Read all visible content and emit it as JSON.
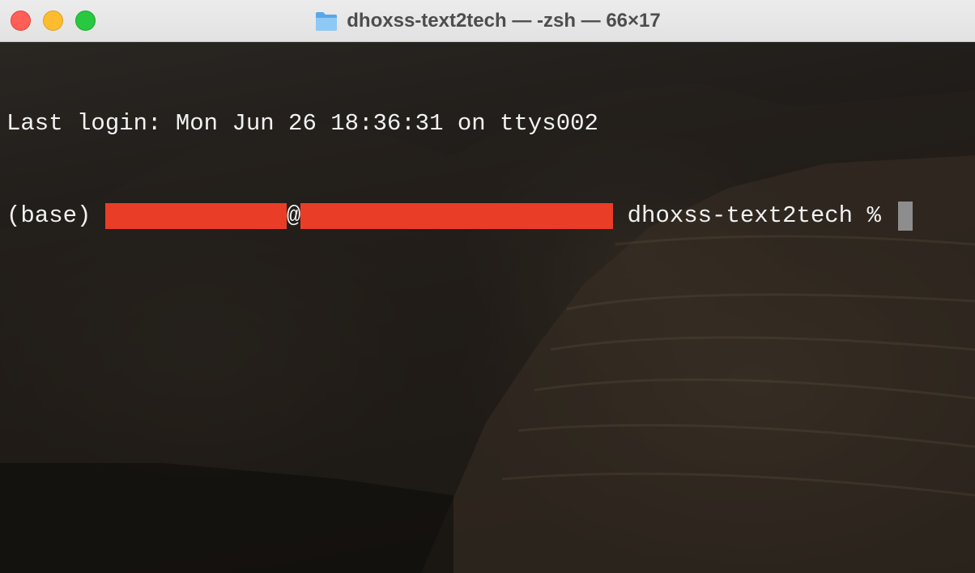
{
  "window": {
    "title": "dhoxss-text2tech — -zsh — 66×17",
    "title_icon": "folder-icon"
  },
  "traffic_lights": {
    "close_color": "#ff5f57",
    "minimize_color": "#febc2e",
    "zoom_color": "#28c840"
  },
  "terminal": {
    "line1": "Last login: Mon Jun 26 18:36:31 on ttys002",
    "prompt_env": "(base) ",
    "prompt_at": "@",
    "prompt_dir": " dhoxss-text2tech % ",
    "redaction_color": "#ea3d28",
    "cursor_color": "#8d8d8d"
  }
}
